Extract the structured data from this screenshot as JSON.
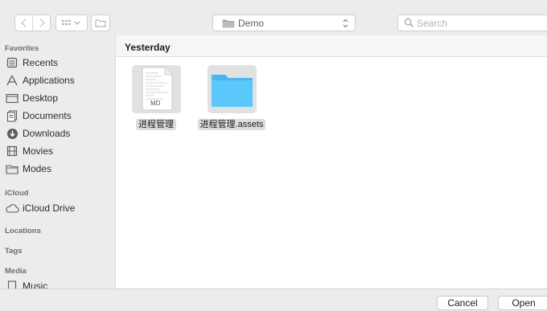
{
  "toolbar": {
    "location_label": "Demo",
    "search_placeholder": "Search"
  },
  "sidebar": {
    "favorites_title": "Favorites",
    "favorites": [
      {
        "label": "Recents",
        "icon": "recents-icon"
      },
      {
        "label": "Applications",
        "icon": "applications-icon"
      },
      {
        "label": "Desktop",
        "icon": "desktop-icon"
      },
      {
        "label": "Documents",
        "icon": "documents-icon"
      },
      {
        "label": "Downloads",
        "icon": "downloads-icon"
      },
      {
        "label": "Movies",
        "icon": "movies-icon"
      },
      {
        "label": "Modes",
        "icon": "folder-icon"
      }
    ],
    "icloud_title": "iCloud",
    "icloud": [
      {
        "label": "iCloud Drive",
        "icon": "cloud-icon"
      }
    ],
    "locations_title": "Locations",
    "tags_title": "Tags",
    "media_title": "Media",
    "media": [
      {
        "label": "Music",
        "icon": "music-icon"
      }
    ]
  },
  "content": {
    "group_title": "Yesterday",
    "files": [
      {
        "name": "进程管理",
        "type": "MD",
        "icon": "markdown-file-icon"
      },
      {
        "name": "进程管理.assets",
        "type": "folder",
        "icon": "folder-icon"
      }
    ]
  },
  "buttons": {
    "cancel": "Cancel",
    "open": "Open"
  },
  "colors": {
    "folder_blue": "#5ac8fa",
    "window_bg": "#ececec"
  }
}
